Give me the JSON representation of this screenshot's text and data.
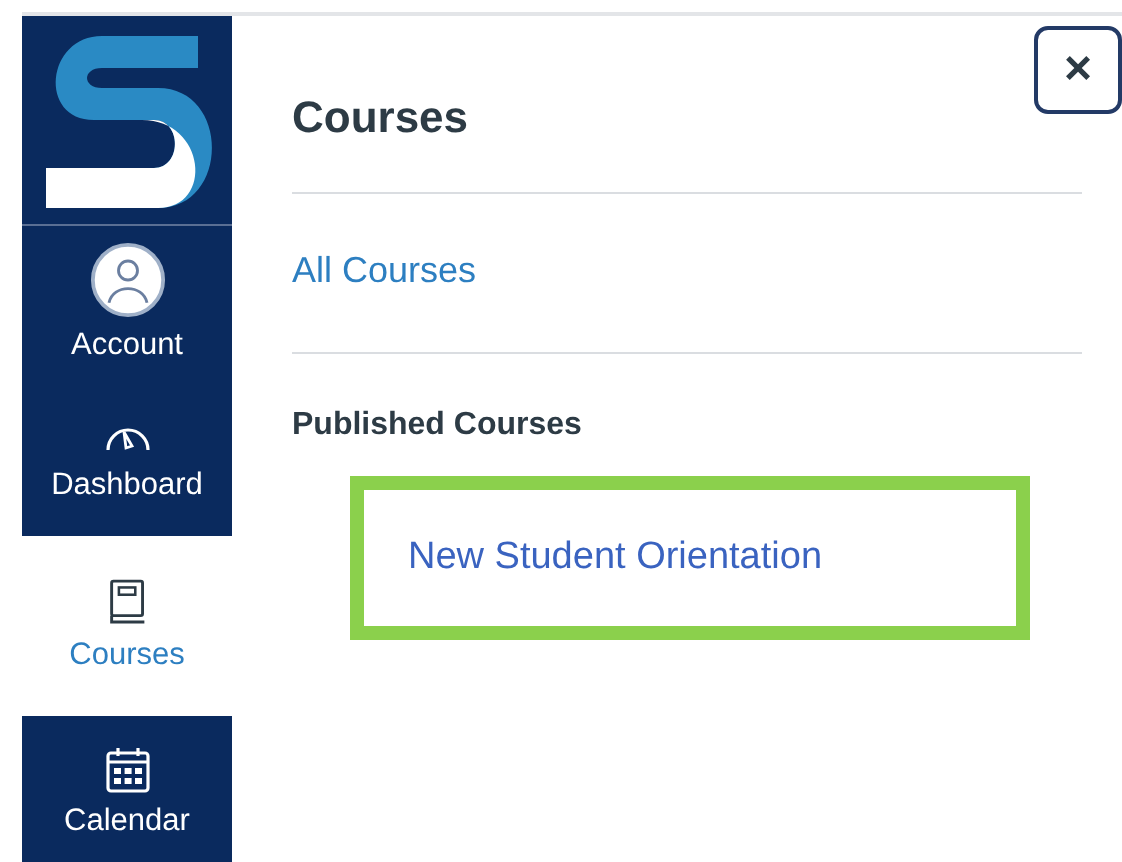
{
  "nav": [
    {
      "label": "Account",
      "selected": false
    },
    {
      "label": "Dashboard",
      "selected": false
    },
    {
      "label": "Courses",
      "selected": true
    },
    {
      "label": "Calendar",
      "selected": false
    }
  ],
  "tray": {
    "title": "Courses",
    "close": "×",
    "all_link": "All Courses",
    "section": "Published Courses",
    "courses": [
      {
        "name": "New Student Orientation",
        "highlighted": true
      }
    ]
  }
}
